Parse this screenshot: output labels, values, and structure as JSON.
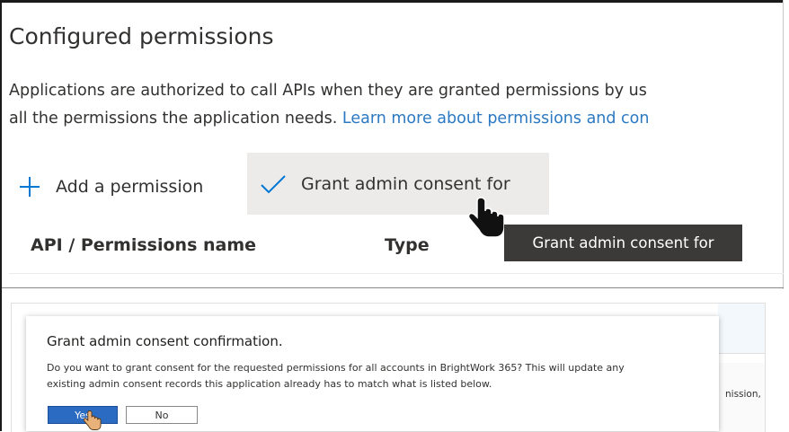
{
  "section": {
    "title": "Configured permissions",
    "description_line1": "Applications are authorized to call APIs when they are granted permissions by us",
    "description_line2_prefix": "all the permissions the application needs. ",
    "learn_more_link": "Learn more about permissions and con"
  },
  "toolbar": {
    "add_permission_label": "Add a permission",
    "grant_consent_label": "Grant admin consent for",
    "tooltip": "Grant admin consent for"
  },
  "table": {
    "headers": [
      "API / Permissions name",
      "Type"
    ]
  },
  "background_panel": {
    "partial_text": "nission, u"
  },
  "dialog": {
    "title": "Grant admin consent confirmation.",
    "body_line1": "Do you want to grant consent for the requested permissions for all accounts in BrightWork 365? This will update any",
    "body_line2": "existing admin consent records this application already has to match what is listed below.",
    "yes_label": "Yes",
    "no_label": "No"
  },
  "icons": {
    "add": "plus-icon",
    "grant": "checkmark-icon",
    "cursor": "hand-pointer-icon"
  },
  "colors": {
    "accent": "#0078d4",
    "link": "#2b79c2",
    "tooltip_bg": "#3b3a39",
    "button_hover_bg": "#edebe9",
    "primary_button": "#2b6cc2"
  }
}
